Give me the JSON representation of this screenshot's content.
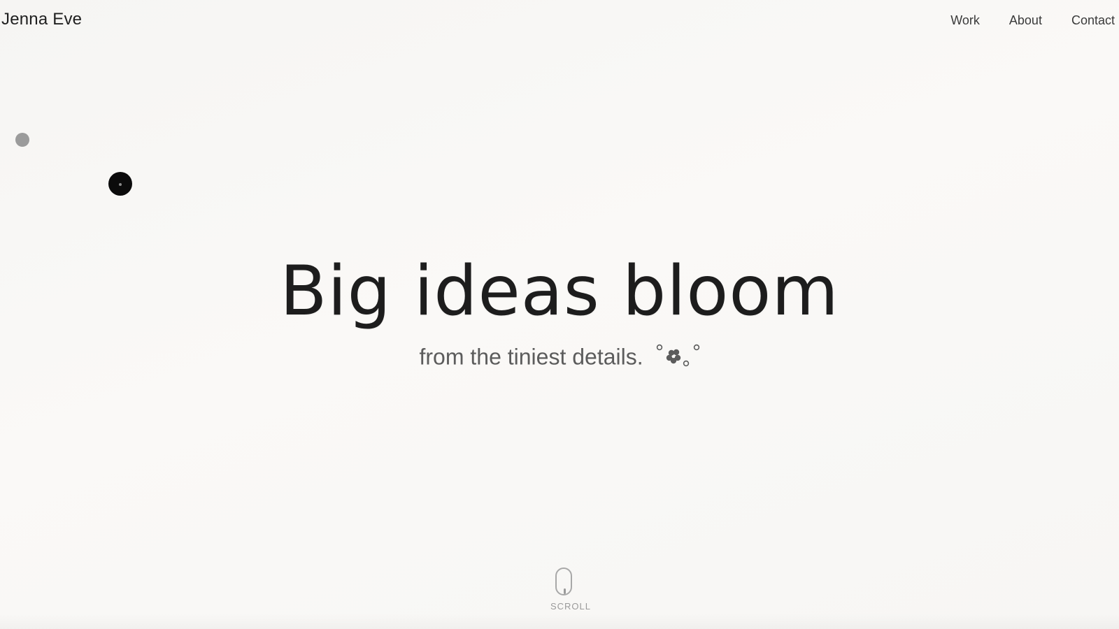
{
  "header": {
    "brand": "Jenna Eve",
    "nav": [
      "Work",
      "About",
      "Contact"
    ]
  },
  "hero": {
    "title": "Big ideas bloom",
    "subtitle": "from the tiniest details.",
    "decoration_icon": "flower-bubbles-icon"
  },
  "scroll": {
    "label": "SCROLL",
    "icon": "mouse-scroll-icon"
  },
  "colors": {
    "background": "#f8f7f5",
    "text_primary": "#1d1d1d",
    "text_secondary": "#5c5c5c",
    "muted": "#9a9a9a",
    "cursor": "#0b0b0b"
  }
}
